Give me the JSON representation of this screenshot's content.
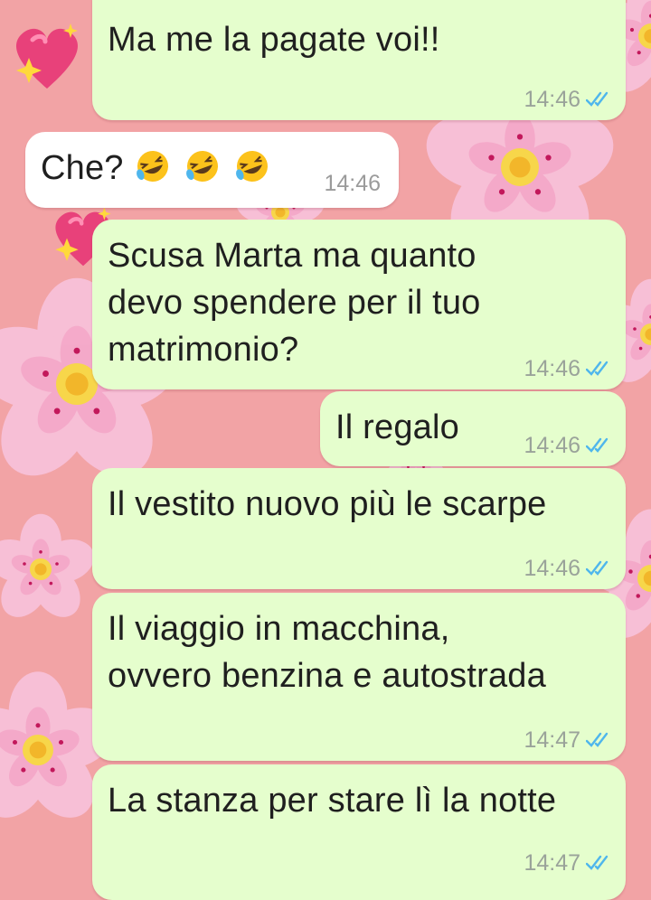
{
  "wallpaper": {
    "background_color": "#f2a3a5",
    "decorations": [
      "heart-icon",
      "cherry-blossom-icon"
    ]
  },
  "messages": [
    {
      "id": "m1",
      "direction": "outgoing",
      "text": "Ma me la pagate voi!!",
      "time": "14:46",
      "status": "read"
    },
    {
      "id": "m2",
      "direction": "incoming",
      "text": "Che?",
      "emoji": [
        "rolling-on-floor-laughing-icon",
        "rolling-on-floor-laughing-icon",
        "rolling-on-floor-laughing-icon"
      ],
      "time": "14:46"
    },
    {
      "id": "m3",
      "direction": "outgoing",
      "lines": [
        "Scusa Marta ma quanto",
        "devo spendere per il tuo",
        "matrimonio?"
      ],
      "time": "14:46",
      "status": "read"
    },
    {
      "id": "m4",
      "direction": "outgoing",
      "text": "Il regalo",
      "time": "14:46",
      "status": "read"
    },
    {
      "id": "m5",
      "direction": "outgoing",
      "text": "Il vestito nuovo più le scarpe",
      "time": "14:46",
      "status": "read"
    },
    {
      "id": "m6",
      "direction": "outgoing",
      "lines": [
        "Il viaggio in macchina,",
        "ovvero benzina e autostrada"
      ],
      "time": "14:47",
      "status": "read"
    },
    {
      "id": "m7",
      "direction": "outgoing",
      "text": "La stanza per stare lì la notte",
      "time": "14:47",
      "status": "read"
    }
  ],
  "colors": {
    "outgoing_bubble": "#e5fecd",
    "incoming_bubble": "#ffffff",
    "read_tick": "#4fb6ec",
    "text": "#1f1f1f",
    "time": "#9aa39a"
  }
}
